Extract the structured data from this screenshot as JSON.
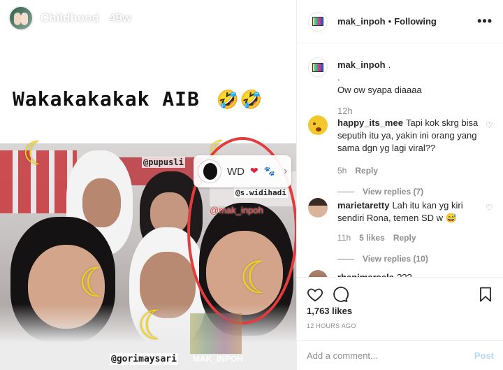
{
  "story": {
    "title": "Childhood",
    "age": "49w",
    "caption": "Wakakakakak AIB",
    "caption_emoji": "🤣🤣",
    "tags": {
      "top": "@pupusli",
      "mid": "@s.widihadi",
      "bottom": "@gorimaysari",
      "red": "@mak_inpoh"
    },
    "mention_card": {
      "name": "WD",
      "heart": "❤",
      "paw": "🐾"
    },
    "watermark": "MAK_INPOH",
    "moon_glyph": "☾"
  },
  "post": {
    "header": {
      "username": "mak_inpoh",
      "separator": "•",
      "follow_status": "Following",
      "more_glyph": "•••"
    },
    "caption": {
      "username": "mak_inpoh",
      "lines": [
        ".",
        ".",
        "Ow ow syapa diaaaa"
      ],
      "time": "12h"
    },
    "comments": [
      {
        "username": "happy_its_mee",
        "text": "Tapi kok skrg bisa seputih itu ya, yakin ini orang yang sama dgn yg lagi viral??",
        "time": "5h",
        "reply_label": "Reply",
        "view_replies": "View replies (7)"
      },
      {
        "username": "marietaretty",
        "text": "Lah itu kan yg kiri sendiri Rona, temen SD w 😅",
        "time": "11h",
        "likes": "5 likes",
        "reply_label": "Reply",
        "view_replies": "View replies (10)"
      },
      {
        "username": "rhanimarsela",
        "text": "???"
      }
    ],
    "likes": "1,763 likes",
    "posted": "12 HOURS AGO",
    "add_comment_placeholder": "Add a comment...",
    "post_label": "Post"
  },
  "colors": {
    "accent_red": "#e23c3c",
    "post_button_disabled": "#b3dbff",
    "muted": "#8e8e8e",
    "text": "#262626"
  }
}
